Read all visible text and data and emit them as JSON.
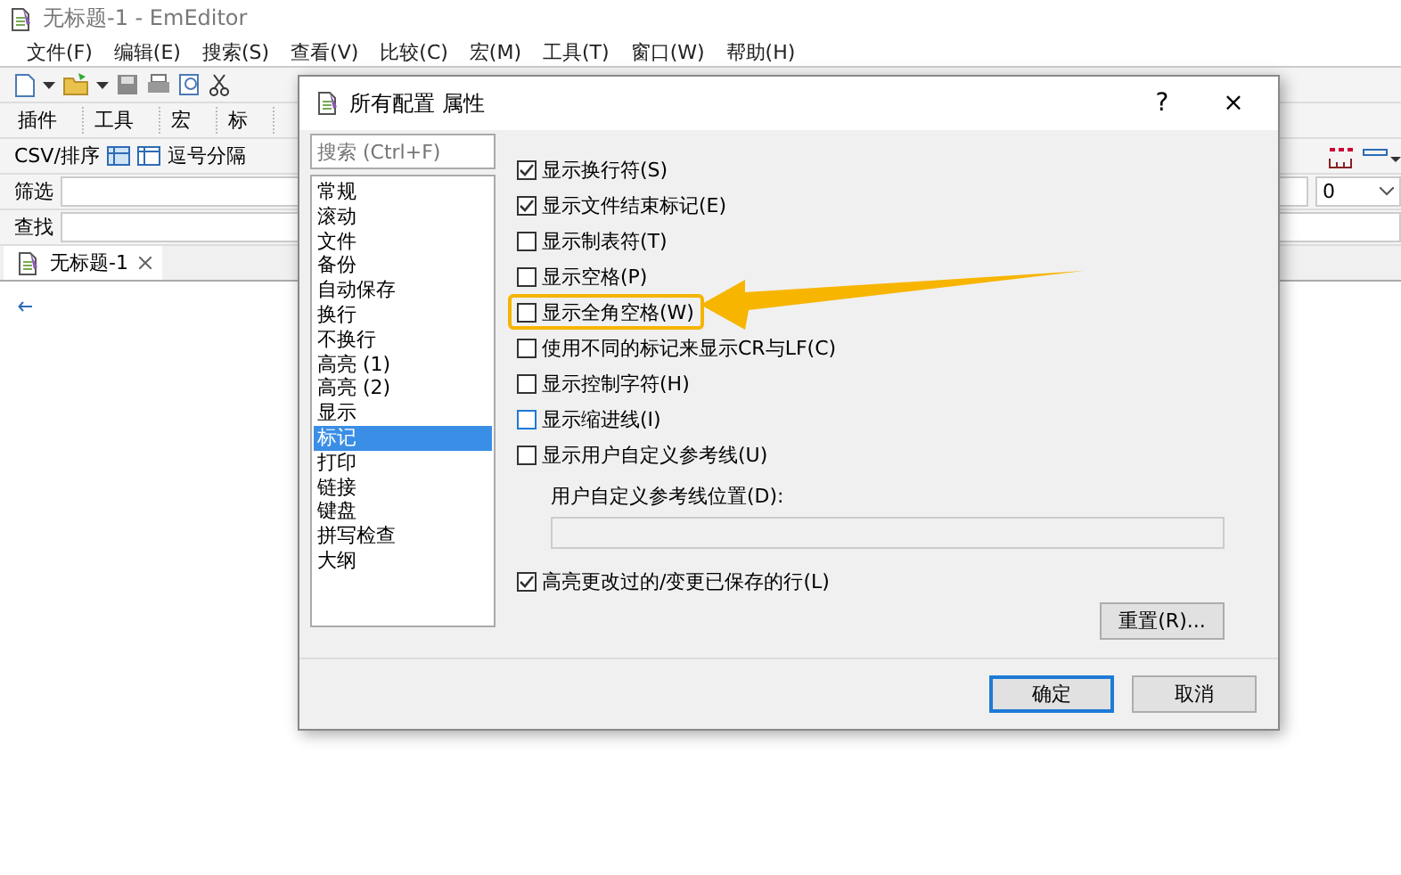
{
  "window": {
    "title": "无标题-1 - EmEditor"
  },
  "menu": [
    "文件(F)",
    "编辑(E)",
    "搜索(S)",
    "查看(V)",
    "比较(C)",
    "宏(M)",
    "工具(T)",
    "窗口(W)",
    "帮助(H)"
  ],
  "toolbar_groups": [
    "插件",
    "工具",
    "宏",
    "标"
  ],
  "csv_bar": {
    "label": "CSV/排序",
    "items": [
      "逗号分隔"
    ]
  },
  "filter_bar": {
    "label": "筛选",
    "combo_value": "0"
  },
  "find_bar": {
    "label": "查找"
  },
  "tabs": [
    {
      "label": "无标题-1",
      "selected": true
    }
  ],
  "dialog": {
    "title": "所有配置 属性",
    "help": "?",
    "close": "×",
    "search": {
      "placeholder": "搜索 (Ctrl+F)"
    },
    "categories": [
      {
        "label": "常规",
        "selected": false
      },
      {
        "label": "滚动",
        "selected": false
      },
      {
        "label": "文件",
        "selected": false
      },
      {
        "label": "备份",
        "selected": false
      },
      {
        "label": "自动保存",
        "selected": false
      },
      {
        "label": "换行",
        "selected": false
      },
      {
        "label": "不换行",
        "selected": false
      },
      {
        "label": "高亮 (1)",
        "selected": false
      },
      {
        "label": "高亮 (2)",
        "selected": false
      },
      {
        "label": "显示",
        "selected": false
      },
      {
        "label": "标记",
        "selected": true
      },
      {
        "label": "打印",
        "selected": false
      },
      {
        "label": "链接",
        "selected": false
      },
      {
        "label": "键盘",
        "selected": false
      },
      {
        "label": "拼写检查",
        "selected": false
      },
      {
        "label": "大纲",
        "selected": false
      }
    ],
    "options": [
      {
        "label": "显示换行符(S)",
        "checked": true,
        "focused": false,
        "highlighted": false
      },
      {
        "label": "显示文件结束标记(E)",
        "checked": true,
        "focused": false,
        "highlighted": false
      },
      {
        "label": "显示制表符(T)",
        "checked": false,
        "focused": false,
        "highlighted": false
      },
      {
        "label": "显示空格(P)",
        "checked": false,
        "focused": false,
        "highlighted": false
      },
      {
        "label": "显示全角空格(W)",
        "checked": false,
        "focused": false,
        "highlighted": true
      },
      {
        "label": "使用不同的标记来显示CR与LF(C)",
        "checked": false,
        "focused": false,
        "highlighted": false
      },
      {
        "label": "显示控制字符(H)",
        "checked": false,
        "focused": false,
        "highlighted": false
      },
      {
        "label": "显示缩进线(I)",
        "checked": false,
        "focused": true,
        "highlighted": false
      },
      {
        "label": "显示用户自定义参考线(U)",
        "checked": false,
        "focused": false,
        "highlighted": false
      }
    ],
    "guide_position": {
      "label": "用户自定义参考线位置(D):"
    },
    "highlight_option": {
      "label": "高亮更改过的/变更已保存的行(L)",
      "checked": true
    },
    "reset_button": "重置(R)...",
    "buttons": [
      {
        "label": "确定",
        "default": true
      },
      {
        "label": "取消",
        "default": false
      }
    ]
  }
}
